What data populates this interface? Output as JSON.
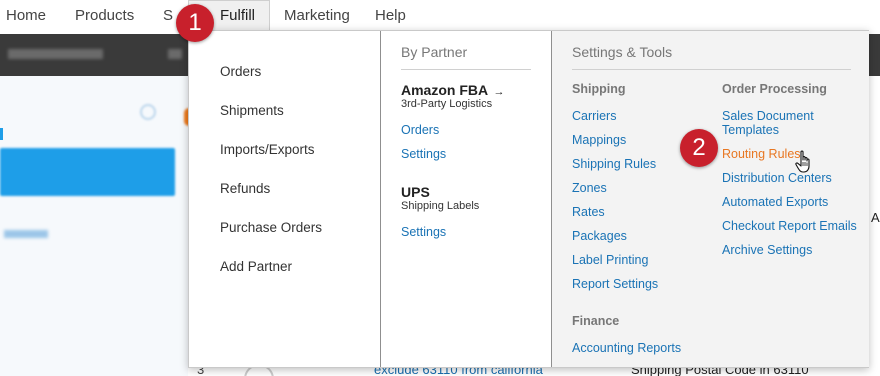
{
  "top_nav": {
    "home": "Home",
    "products": "Products",
    "sales_partial": "S",
    "fulfill": "Fulfill",
    "marketing": "Marketing",
    "help": "Help"
  },
  "fulfill_menu": {
    "column1": [
      "Orders",
      "Shipments",
      "Imports/Exports",
      "Refunds",
      "Purchase Orders",
      "Add Partner"
    ],
    "by_partner": {
      "header": "By Partner",
      "partners": [
        {
          "name": "Amazon FBA",
          "arrow": "→",
          "subtitle": "3rd-Party Logistics",
          "links": [
            "Orders",
            "Settings"
          ]
        },
        {
          "name": "UPS",
          "subtitle": "Shipping Labels",
          "links": [
            "Settings"
          ]
        }
      ]
    },
    "settings_tools": {
      "header": "Settings & Tools",
      "shipping": {
        "heading": "Shipping",
        "links": [
          "Carriers",
          "Mappings",
          "Shipping Rules",
          "Zones",
          "Rates",
          "Packages",
          "Label Printing",
          "Report Settings"
        ]
      },
      "finance": {
        "heading": "Finance",
        "links": [
          "Accounting Reports"
        ]
      },
      "order_processing": {
        "heading": "Order Processing",
        "links": [
          "Sales Document Templates",
          "Routing Rules",
          "Distribution Centers",
          "Automated Exports",
          "Checkout Report Emails",
          "Archive Settings"
        ],
        "hovered": "Routing Rules"
      }
    }
  },
  "badges": [
    "1",
    "2"
  ],
  "background": {
    "right_edge_text": "A",
    "bottom_row_number": "3",
    "bottom_row_link": "exclude 63110 from california",
    "bottom_row_rule": "Shipping Postal Code in 63110"
  },
  "colors": {
    "link": "#1a73b5",
    "hover_link": "#e87722",
    "badge": "#c8202c",
    "sidebar_active": "#1e9ee8"
  },
  "icons": {
    "cursor": "hand-pointer-icon"
  }
}
